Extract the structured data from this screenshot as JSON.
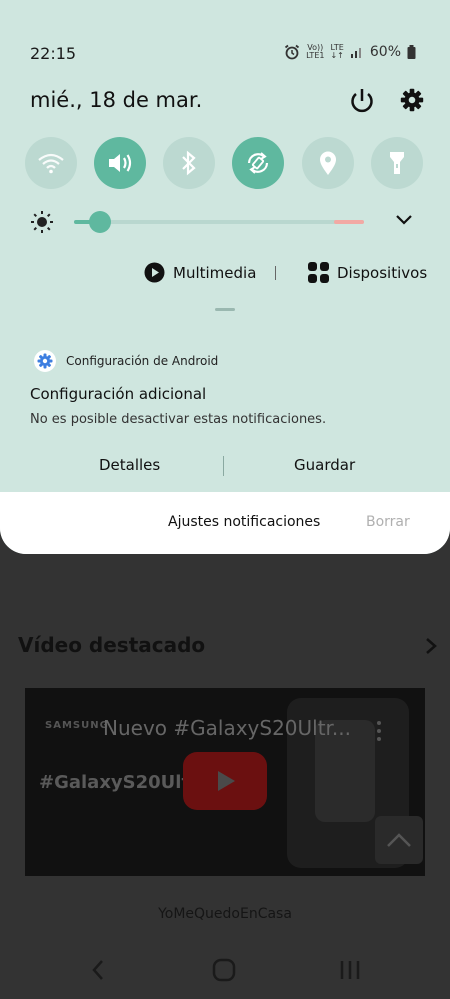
{
  "status": {
    "time": "22:15",
    "carrier_top": "Vo))",
    "carrier_bottom": "LTE1",
    "network_top": "LTE",
    "network_bottom": "↓↑",
    "battery": "60%"
  },
  "header": {
    "date": "mié., 18 de mar."
  },
  "quick_tiles": [
    {
      "name": "wifi",
      "state": "off"
    },
    {
      "name": "sound",
      "state": "on"
    },
    {
      "name": "bluetooth",
      "state": "off"
    },
    {
      "name": "auto-rotate",
      "state": "on"
    },
    {
      "name": "location",
      "state": "off"
    },
    {
      "name": "flashlight",
      "state": "off"
    }
  ],
  "brightness": {
    "level": 0.09
  },
  "media": {
    "multimedia_label": "Multimedia",
    "devices_label": "Dispositivos"
  },
  "notification": {
    "app_name": "Configuración de Android",
    "title": "Configuración adicional",
    "text": "No es posible desactivar estas notificaciones.",
    "actions": {
      "details": "Detalles",
      "save": "Guardar"
    }
  },
  "footer": {
    "settings_label": "Ajustes notificaciones",
    "clear_label": "Borrar"
  },
  "background_app": {
    "section_title": "Vídeo destacado",
    "video": {
      "brand": "SAMSUNG",
      "title": "Nuevo #GalaxyS20Ultr...",
      "hashtag_overlay": "#GalaxyS20Ultr"
    },
    "hashtag": "YoMeQuedoEnCasa"
  },
  "colors": {
    "accent": "#5fb89f",
    "shade_bg": "#cfe6df",
    "tile_off": "#bcd9d1"
  }
}
